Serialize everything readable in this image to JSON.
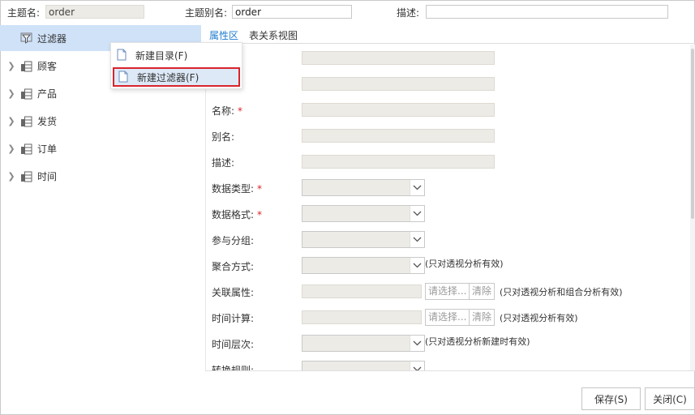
{
  "header": {
    "subject_name_label": "主题名:",
    "subject_name_value": "order",
    "subject_alias_label": "主题别名:",
    "subject_alias_value": "order",
    "desc_label": "描述:",
    "desc_value": ""
  },
  "tree": {
    "items": [
      {
        "label": "过滤器",
        "icon": "filter-icon",
        "selected": true
      },
      {
        "label": "顾客",
        "icon": "table-folder-icon"
      },
      {
        "label": "产品",
        "icon": "table-folder-icon"
      },
      {
        "label": "发货",
        "icon": "table-folder-icon"
      },
      {
        "label": "订单",
        "icon": "table-folder-icon"
      },
      {
        "label": "时间",
        "icon": "table-folder-icon"
      }
    ]
  },
  "context_menu": {
    "items": [
      {
        "label": "新建目录(F)",
        "icon": "file-icon"
      },
      {
        "label": "新建过滤器(F)",
        "icon": "file-icon",
        "highlighted": true
      }
    ]
  },
  "tabs": [
    {
      "label": "属性区",
      "active": true
    },
    {
      "label": "表关系视图",
      "active": false
    }
  ],
  "form": {
    "name_label": "名称:",
    "alias_label": "别名:",
    "desc_label": "描述:",
    "data_type_label": "数据类型:",
    "data_format_label": "数据格式:",
    "group_label": "参与分组:",
    "aggregate_label": "聚合方式:",
    "aggregate_note": "(只对透视分析有效)",
    "relation_label": "关联属性:",
    "relation_select_btn": "请选择...",
    "relation_clear_btn": "清除",
    "relation_note": "(只对透视分析和组合分析有效)",
    "time_calc_label": "时间计算:",
    "time_calc_select_btn": "请选择...",
    "time_calc_clear_btn": "清除",
    "time_calc_note": "(只对透视分析有效)",
    "time_level_label": "时间层次:",
    "time_level_note": "(只对透视分析新建时有效)",
    "convert_rule_label": "转换规则:"
  },
  "footer": {
    "save_label": "保存(S)",
    "close_label": "关闭(C)"
  },
  "colors": {
    "accent": "#1e7bd0",
    "selected_bg": "#cfe2f8",
    "highlight_border": "#d9242b",
    "required": "#d9242b",
    "readonly_bg": "#ecebe6"
  }
}
